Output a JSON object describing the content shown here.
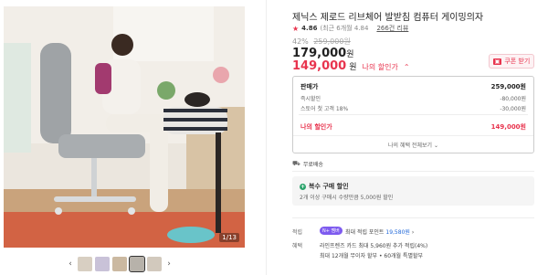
{
  "product": {
    "title": "제닉스 제로드 리브체어 발받침 컴퓨터 게이밍의자",
    "rating": "4.86",
    "rating_note": "(최근 6개월 4.84",
    "review_count": "266건 리뷰",
    "discount_rate": "42%",
    "original_price": "259,000원",
    "sale_price": "179,000",
    "my_price": "149,000",
    "currency": "원",
    "my_price_label": "나의 할인가",
    "coupon_label": "쿠폰 받기"
  },
  "price_box": {
    "rows": [
      {
        "label": "판매가",
        "value": "259,000원"
      },
      {
        "label": "즉시할인",
        "value": "-80,000원"
      },
      {
        "label": "스토어 첫 고객 18%",
        "value": "-30,000원"
      },
      {
        "label": "나의 할인가",
        "value": "149,000원"
      }
    ],
    "benefits_link": "나의 혜택 전체보기"
  },
  "shipping": "무료배송",
  "multi_discount": {
    "title": "복수 구매 할인",
    "desc": "2개 이상 구매시 수량만큼 5,000원 할인"
  },
  "points": {
    "label": "적립",
    "badge": "N+ 멤버",
    "text": "최대 적립 포인트",
    "value": "19,580원"
  },
  "benefits": {
    "label": "혜택",
    "line1": "라인프렌즈 카드 최대 5,960원 추가 적립(4%)",
    "line2": "최대 12개월 무이자 할부 • 60개월 특별할부"
  },
  "gallery": {
    "counter": "1/13",
    "prev": "‹",
    "next": "›"
  },
  "colors": {
    "accent": "#e8344e",
    "link": "#1e66d8"
  }
}
